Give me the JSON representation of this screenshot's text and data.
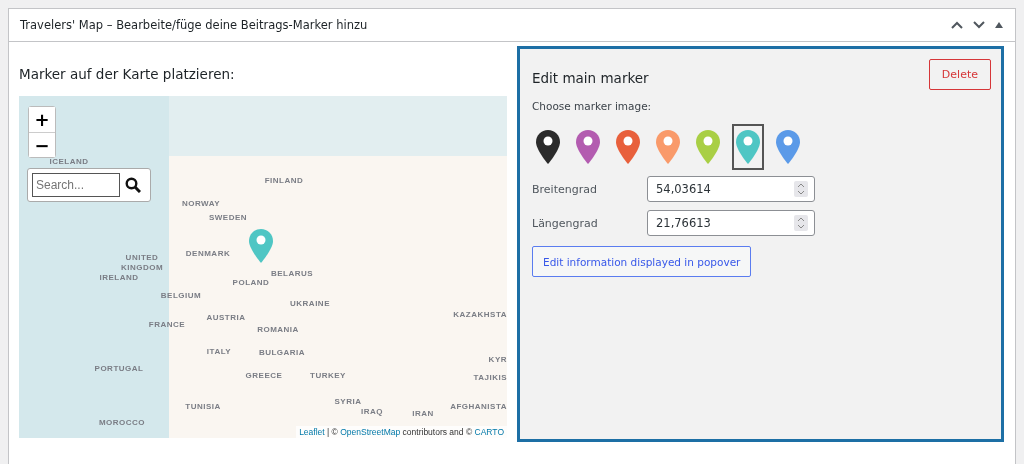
{
  "metabox": {
    "title": "Travelers' Map – Bearbeite/füge deine Beitrags-Marker hinzu"
  },
  "map_section": {
    "heading": "Marker auf der Karte platzieren:",
    "zoom_in": "+",
    "zoom_out": "−",
    "search": {
      "placeholder": "Search..."
    },
    "labels": [
      "ICELAND",
      "FINLAND",
      "NORWAY",
      "SWEDEN",
      "UNITED",
      "KINGDOM",
      "IRELAND",
      "DENMARK",
      "BELARUS",
      "POLAND",
      "BELGIUM",
      "UKRAINE",
      "KAZAKHSTA",
      "AUSTRIA",
      "FRANCE",
      "ROMANIA",
      "ITALY",
      "BULGARIA",
      "KYR",
      "PORTUGAL",
      "GREECE",
      "TURKEY",
      "TAJIKIS",
      "TUNISIA",
      "SYRIA",
      "IRAQ",
      "IRAN",
      "AFGHANISTA",
      "MOROCCO"
    ],
    "attribution": [
      {
        "kind": "link",
        "text": "Leaflet"
      },
      {
        "kind": "text",
        "text": " | © "
      },
      {
        "kind": "link",
        "text": "OpenStreetMap"
      },
      {
        "kind": "text",
        "text": " contributors and © "
      },
      {
        "kind": "link",
        "text": "CARTO"
      }
    ]
  },
  "edit_panel": {
    "title": "Edit main marker",
    "delete_button": "Delete",
    "marker_label": "Choose marker image:",
    "markers": [
      {
        "color": "#2b2b2b",
        "selected": false
      },
      {
        "color": "#b35cb0",
        "selected": false
      },
      {
        "color": "#e8603c",
        "selected": false
      },
      {
        "color": "#f99a6a",
        "selected": false
      },
      {
        "color": "#a9cf45",
        "selected": false
      },
      {
        "color": "#4fc6c4",
        "selected": true
      },
      {
        "color": "#5b9ae8",
        "selected": false
      }
    ],
    "fields": [
      {
        "label": "Breitengrad",
        "value": "54,03614"
      },
      {
        "label": "Längengrad",
        "value": "21,76613"
      }
    ],
    "popover_button": "Edit information displayed in popover"
  }
}
